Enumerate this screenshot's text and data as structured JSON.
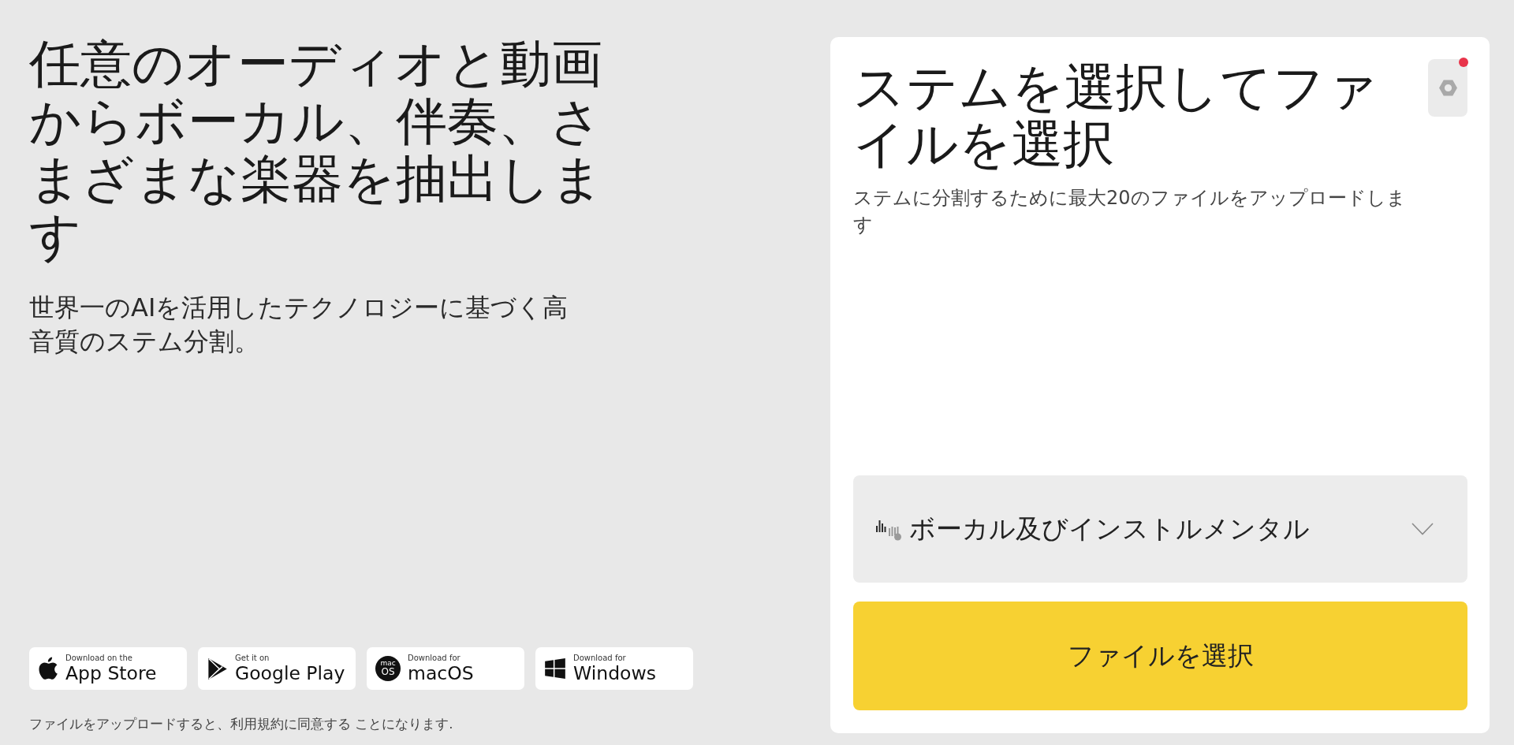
{
  "hero": {
    "title": "任意のオーディオと動画からボーカル、伴奏、さまざまな楽器を抽出します",
    "subtitle": "世界一のAIを活用したテクノロジーに基づく高音質のステム分割。"
  },
  "store_badges": [
    {
      "kind": "apple",
      "caption": "Download on the",
      "label": "App Store"
    },
    {
      "kind": "google_play",
      "caption": "Get it on",
      "label": "Google Play"
    },
    {
      "kind": "macos",
      "caption": "Download for",
      "label": "macOS",
      "emblem_top": "mac",
      "emblem_bottom": "OS"
    },
    {
      "kind": "windows",
      "caption": "Download for",
      "label": "Windows"
    }
  ],
  "terms_notice": "ファイルをアップロードすると、利用規約に同意する ことになります.",
  "upload_card": {
    "title": "ステムを選択してファイルを選択",
    "description": "ステムに分割するために最大20のファイルをアップロードします",
    "settings_button": {
      "notification": true
    },
    "stem_select": {
      "value": "ボーカル及びインストルメンタル",
      "expanded": false
    },
    "button": "ファイルを選択"
  }
}
